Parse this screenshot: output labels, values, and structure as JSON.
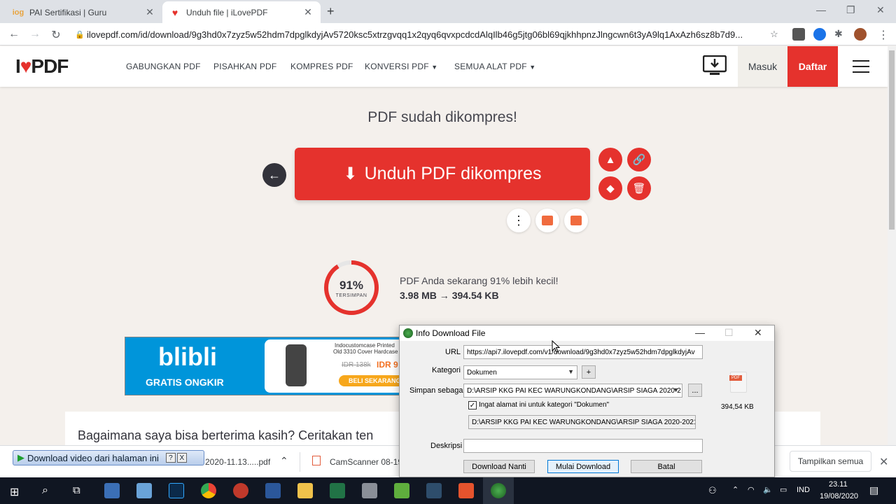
{
  "browser": {
    "tabs": [
      {
        "title": "PAI Sertifikasi | Guru",
        "favicon": "iog-icon"
      },
      {
        "title": "Unduh file | iLovePDF",
        "favicon": "heart-icon"
      }
    ],
    "url": "ilovepdf.com/id/download/9g3hd0x7zyz5w52hdm7dpglkdyjAv5720ksc5xtrzgvqq1x2qyq6qvxpcdcdAlqIlb46g5jtg06bl69qjkhhpnzJlngcwn6t3yA9lq1AxAzh6sz8b7d9..."
  },
  "site": {
    "logo_i": "I",
    "logo_pdf": "PDF",
    "nav": [
      "GABUNGKAN PDF",
      "PISAHKAN PDF",
      "KOMPRES PDF",
      "KONVERSI PDF",
      "SEMUA ALAT PDF"
    ],
    "masuk": "Masuk",
    "daftar": "Daftar"
  },
  "main": {
    "heading": "PDF sudah dikompres!",
    "download_label": "Unduh PDF dikompres",
    "percent": "91%",
    "percent_value": 91,
    "percent_caption": "TERSIMPAN",
    "smaller_text": "PDF Anda sekarang 91% lebih kecil!",
    "sizes_text": "3.98 MB → 394.54 KB",
    "feedback_text": "Bagaimana saya bisa berterima kasih? Ceritakan ten"
  },
  "ad": {
    "brand": "blibli",
    "shipping": "GRATIS ONGKIR",
    "line1": "Indocustomcase Printed",
    "line2": "Old 3310 Cover Hardcase",
    "old_price": "IDR 138k",
    "new_price": "IDR 9",
    "cta": "BELI SEKARANG"
  },
  "dialog": {
    "title": "Info Download File",
    "url_label": "URL",
    "url_value": "https://api7.ilovepdf.com/v1/download/9g3hd0x7zyz5w52hdm7dpglkdyjAv",
    "kategori_label": "Kategori",
    "kategori_value": "Dokumen",
    "plus": "+",
    "simpan_label": "Simpan sebagai",
    "simpan_value": "D:\\ARSIP KKG PAI KEC WARUNGKONDANG\\ARSIP SIAGA 2020-2",
    "browse": "...",
    "remember": "Ingat alamat ini untuk kategori \"Dokumen\"",
    "path_value": "D:\\ARSIP KKG PAI KEC WARUNGKONDANG\\ARSIP SIAGA 2020-2021\\",
    "deskripsi_label": "Deskripsi",
    "file_size": "394,54 KB",
    "btn_later": "Download Nanti",
    "btn_start": "Mulai Download",
    "btn_cancel": "Batal"
  },
  "downloads": {
    "video_btn": "Download video dari halaman ini",
    "help": "?",
    "close": "X",
    "file1": "2020-11.13.....pdf",
    "file2": "CamScanner 08-19...",
    "show_all": "Tampilkan semua"
  },
  "taskbar": {
    "lang": "IND",
    "time": "23.11",
    "date": "19/08/2020"
  },
  "colors": {
    "brand_red": "#e5322d",
    "dark": "#33333b"
  }
}
